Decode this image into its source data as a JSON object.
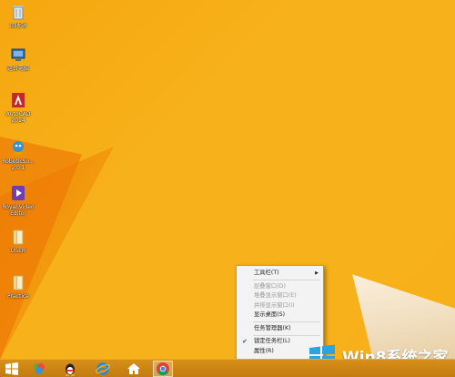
{
  "desktop": {
    "icons": [
      {
        "label": "回收站",
        "label2": "",
        "color": "#cfd8dc"
      },
      {
        "label": "这台电脑",
        "label2": "",
        "color": "#5a7fb0"
      },
      {
        "label": "AutoCAD",
        "label2": "2014",
        "color": "#c62828"
      },
      {
        "label": "RoboticSo...",
        "label2": "2.0.1",
        "color": "#3a8fd0"
      },
      {
        "label": "Royal Video",
        "label2": "Editor",
        "color": "#6d3fb0"
      },
      {
        "label": "USER",
        "label2": "",
        "color": "#f3e7c0"
      },
      {
        "label": "Practice",
        "label2": "",
        "color": "#f3e7c0"
      }
    ]
  },
  "context_menu": {
    "items": [
      {
        "label": "工具栏(T)",
        "disabled": false,
        "submenu": true,
        "checked": false
      },
      {
        "label": "层叠窗口(D)",
        "disabled": true,
        "submenu": false,
        "checked": false
      },
      {
        "label": "堆叠显示窗口(E)",
        "disabled": true,
        "submenu": false,
        "checked": false
      },
      {
        "label": "并排显示窗口(I)",
        "disabled": true,
        "submenu": false,
        "checked": false
      },
      {
        "label": "显示桌面(S)",
        "disabled": false,
        "submenu": false,
        "checked": false
      },
      {
        "label": "任务管理器(K)",
        "disabled": false,
        "submenu": false,
        "checked": false
      },
      {
        "label": "锁定任务栏(L)",
        "disabled": false,
        "submenu": false,
        "checked": true
      },
      {
        "label": "属性(R)",
        "disabled": false,
        "submenu": false,
        "checked": false
      }
    ]
  },
  "taskbar": {
    "buttons": [
      "start-button",
      "colorful-app",
      "qq-penguin",
      "internet-explorer",
      "home",
      "chrome"
    ],
    "active": "chrome"
  },
  "watermark": {
    "text": "Win8系统之家"
  },
  "colors": {
    "wallpaper": "#f7b01a",
    "taskbar": "#c9850f",
    "checkmark": "#1e5a9e"
  }
}
